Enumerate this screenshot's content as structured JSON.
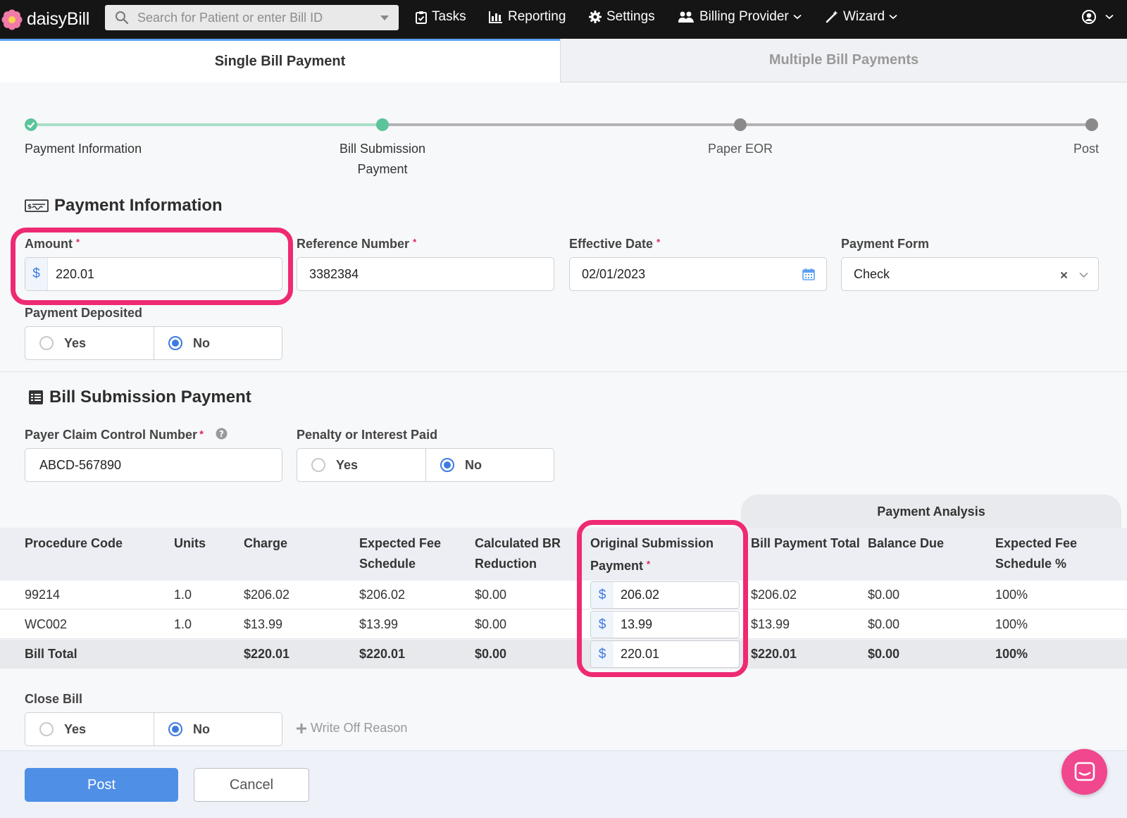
{
  "app": {
    "logo_text": "daisyBill"
  },
  "navbar": {
    "search_placeholder": "Search for Patient or enter Bill ID",
    "items": [
      {
        "label": "Tasks",
        "icon": "clipboard-check-icon"
      },
      {
        "label": "Reporting",
        "icon": "bar-chart-icon"
      },
      {
        "label": "Settings",
        "icon": "gear-icon"
      },
      {
        "label": "Billing Provider",
        "icon": "users-icon"
      },
      {
        "label": "Wizard",
        "icon": "magic-wand-icon"
      }
    ],
    "user_icon": "user-circle-icon"
  },
  "tabs": {
    "single": "Single Bill Payment",
    "multiple": "Multiple Bill Payments"
  },
  "stepper": {
    "steps": [
      {
        "label": "Payment Information",
        "state": "complete"
      },
      {
        "label": "Bill Submission",
        "label2": "Payment",
        "state": "current"
      },
      {
        "label": "Paper EOR",
        "state": "pending"
      },
      {
        "label": "Post",
        "state": "pending"
      }
    ],
    "colors": {
      "complete": "#5cc49a",
      "line_done": "#a8dfc6",
      "line_pending": "#b3b3b3",
      "dot_pending": "#8a8a8a"
    }
  },
  "payment_info": {
    "title": "Payment Information",
    "amount": {
      "label": "Amount",
      "value": "220.01",
      "currency": "$"
    },
    "reference_number": {
      "label": "Reference Number",
      "value": "3382384"
    },
    "effective_date": {
      "label": "Effective Date",
      "value": "02/01/2023"
    },
    "payment_form": {
      "label": "Payment Form",
      "value": "Check"
    },
    "payment_deposited": {
      "label": "Payment Deposited",
      "yes": "Yes",
      "no": "No",
      "selected": "No"
    }
  },
  "bill_submission": {
    "title": "Bill Submission Payment",
    "pccn": {
      "label": "Payer Claim Control Number",
      "value": "ABCD-567890"
    },
    "penalty": {
      "label": "Penalty or Interest Paid",
      "yes": "Yes",
      "no": "No",
      "selected": "No"
    }
  },
  "table": {
    "analysis_header": "Payment Analysis",
    "headers": {
      "procedure_code": "Procedure Code",
      "units": "Units",
      "charge": "Charge",
      "efs_1": "Expected Fee",
      "efs_2": "Schedule",
      "cbr_1": "Calculated BR",
      "cbr_2": "Reduction",
      "osp_1": "Original Submission",
      "osp_2": "Payment",
      "bpt": "Bill Payment Total",
      "balance": "Balance Due",
      "efsp_1": "Expected Fee",
      "efsp_2": "Schedule %"
    },
    "rows": [
      {
        "code": "99214",
        "units": "1.0",
        "charge": "$206.02",
        "efs": "$206.02",
        "cbr": "$0.00",
        "osp": "206.02",
        "bpt": "$206.02",
        "balance": "$0.00",
        "efsp": "100%"
      },
      {
        "code": "WC002",
        "units": "1.0",
        "charge": "$13.99",
        "efs": "$13.99",
        "cbr": "$0.00",
        "osp": "13.99",
        "bpt": "$13.99",
        "balance": "$0.00",
        "efsp": "100%"
      }
    ],
    "total": {
      "label": "Bill Total",
      "charge": "$220.01",
      "efs": "$220.01",
      "cbr": "$0.00",
      "osp": "220.01",
      "bpt": "$220.01",
      "balance": "$0.00",
      "efsp": "100%"
    }
  },
  "close_bill": {
    "label": "Close Bill",
    "yes": "Yes",
    "no": "No",
    "selected": "No",
    "write_off": "Write Off Reason"
  },
  "footer": {
    "post": "Post",
    "cancel": "Cancel"
  },
  "colors": {
    "accent": "#4f8fe6",
    "highlight": "#ee2a72",
    "chat": "#f0478e"
  }
}
